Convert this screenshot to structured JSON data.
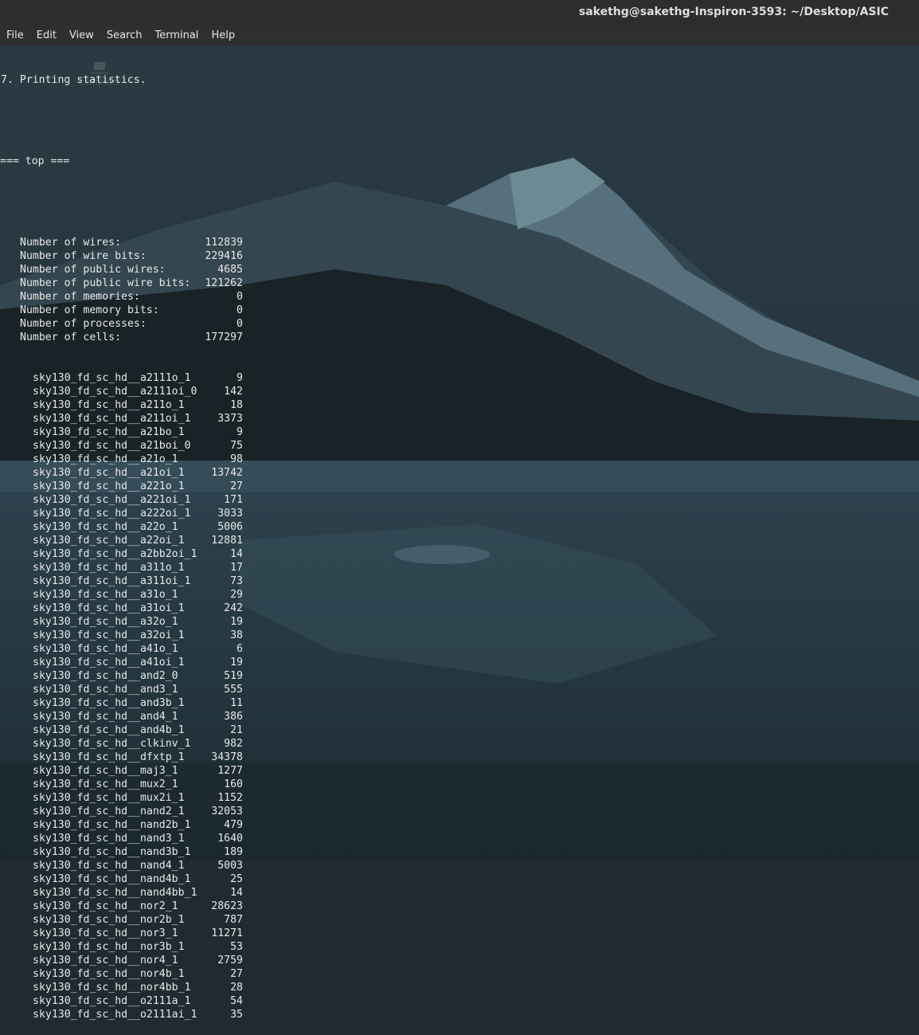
{
  "window": {
    "title": "sakethg@sakethg-Inspiron-3593: ~/Desktop/ASIC"
  },
  "menu": [
    "File",
    "Edit",
    "View",
    "Search",
    "Terminal",
    "Help"
  ],
  "desktop": {
    "icon_label": "Computer"
  },
  "terminal": {
    "line1": "7. Printing statistics.",
    "section": "=== top ===",
    "stats": [
      {
        "label": "Number of wires:",
        "value": "112839"
      },
      {
        "label": "Number of wire bits:",
        "value": "229416"
      },
      {
        "label": "Number of public wires:",
        "value": "4685"
      },
      {
        "label": "Number of public wire bits:",
        "value": "121262"
      },
      {
        "label": "Number of memories:",
        "value": "0"
      },
      {
        "label": "Number of memory bits:",
        "value": "0"
      },
      {
        "label": "Number of processes:",
        "value": "0"
      },
      {
        "label": "Number of cells:",
        "value": "177297"
      }
    ],
    "cells": [
      {
        "name": "sky130_fd_sc_hd__a2111o_1",
        "count": "9"
      },
      {
        "name": "sky130_fd_sc_hd__a2111oi_0",
        "count": "142"
      },
      {
        "name": "sky130_fd_sc_hd__a211o_1",
        "count": "18"
      },
      {
        "name": "sky130_fd_sc_hd__a211oi_1",
        "count": "3373"
      },
      {
        "name": "sky130_fd_sc_hd__a21bo_1",
        "count": "9"
      },
      {
        "name": "sky130_fd_sc_hd__a21boi_0",
        "count": "75"
      },
      {
        "name": "sky130_fd_sc_hd__a21o_1",
        "count": "98"
      },
      {
        "name": "sky130_fd_sc_hd__a21oi_1",
        "count": "13742"
      },
      {
        "name": "sky130_fd_sc_hd__a221o_1",
        "count": "27"
      },
      {
        "name": "sky130_fd_sc_hd__a221oi_1",
        "count": "171"
      },
      {
        "name": "sky130_fd_sc_hd__a222oi_1",
        "count": "3033"
      },
      {
        "name": "sky130_fd_sc_hd__a22o_1",
        "count": "5006"
      },
      {
        "name": "sky130_fd_sc_hd__a22oi_1",
        "count": "12881"
      },
      {
        "name": "sky130_fd_sc_hd__a2bb2oi_1",
        "count": "14"
      },
      {
        "name": "sky130_fd_sc_hd__a311o_1",
        "count": "17"
      },
      {
        "name": "sky130_fd_sc_hd__a311oi_1",
        "count": "73"
      },
      {
        "name": "sky130_fd_sc_hd__a31o_1",
        "count": "29"
      },
      {
        "name": "sky130_fd_sc_hd__a31oi_1",
        "count": "242"
      },
      {
        "name": "sky130_fd_sc_hd__a32o_1",
        "count": "19"
      },
      {
        "name": "sky130_fd_sc_hd__a32oi_1",
        "count": "38"
      },
      {
        "name": "sky130_fd_sc_hd__a41o_1",
        "count": "6"
      },
      {
        "name": "sky130_fd_sc_hd__a41oi_1",
        "count": "19"
      },
      {
        "name": "sky130_fd_sc_hd__and2_0",
        "count": "519"
      },
      {
        "name": "sky130_fd_sc_hd__and3_1",
        "count": "555"
      },
      {
        "name": "sky130_fd_sc_hd__and3b_1",
        "count": "11"
      },
      {
        "name": "sky130_fd_sc_hd__and4_1",
        "count": "386"
      },
      {
        "name": "sky130_fd_sc_hd__and4b_1",
        "count": "21"
      },
      {
        "name": "sky130_fd_sc_hd__clkinv_1",
        "count": "982"
      },
      {
        "name": "sky130_fd_sc_hd__dfxtp_1",
        "count": "34378"
      },
      {
        "name": "sky130_fd_sc_hd__maj3_1",
        "count": "1277"
      },
      {
        "name": "sky130_fd_sc_hd__mux2_1",
        "count": "160"
      },
      {
        "name": "sky130_fd_sc_hd__mux2i_1",
        "count": "1152"
      },
      {
        "name": "sky130_fd_sc_hd__nand2_1",
        "count": "32053"
      },
      {
        "name": "sky130_fd_sc_hd__nand2b_1",
        "count": "479"
      },
      {
        "name": "sky130_fd_sc_hd__nand3_1",
        "count": "1640"
      },
      {
        "name": "sky130_fd_sc_hd__nand3b_1",
        "count": "189"
      },
      {
        "name": "sky130_fd_sc_hd__nand4_1",
        "count": "5003"
      },
      {
        "name": "sky130_fd_sc_hd__nand4b_1",
        "count": "25"
      },
      {
        "name": "sky130_fd_sc_hd__nand4bb_1",
        "count": "14"
      },
      {
        "name": "sky130_fd_sc_hd__nor2_1",
        "count": "28623"
      },
      {
        "name": "sky130_fd_sc_hd__nor2b_1",
        "count": "787"
      },
      {
        "name": "sky130_fd_sc_hd__nor3_1",
        "count": "11271"
      },
      {
        "name": "sky130_fd_sc_hd__nor3b_1",
        "count": "53"
      },
      {
        "name": "sky130_fd_sc_hd__nor4_1",
        "count": "2759"
      },
      {
        "name": "sky130_fd_sc_hd__nor4b_1",
        "count": "27"
      },
      {
        "name": "sky130_fd_sc_hd__nor4bb_1",
        "count": "28"
      },
      {
        "name": "sky130_fd_sc_hd__o2111a_1",
        "count": "54"
      },
      {
        "name": "sky130_fd_sc_hd__o2111ai_1",
        "count": "35"
      }
    ]
  },
  "colors": {
    "terminal_text": "#e8e8e8",
    "titlebar_bg": "#2d2d2d",
    "menubar_bg": "#2f2f2f",
    "wallpaper_bg": "#1f2b31"
  }
}
